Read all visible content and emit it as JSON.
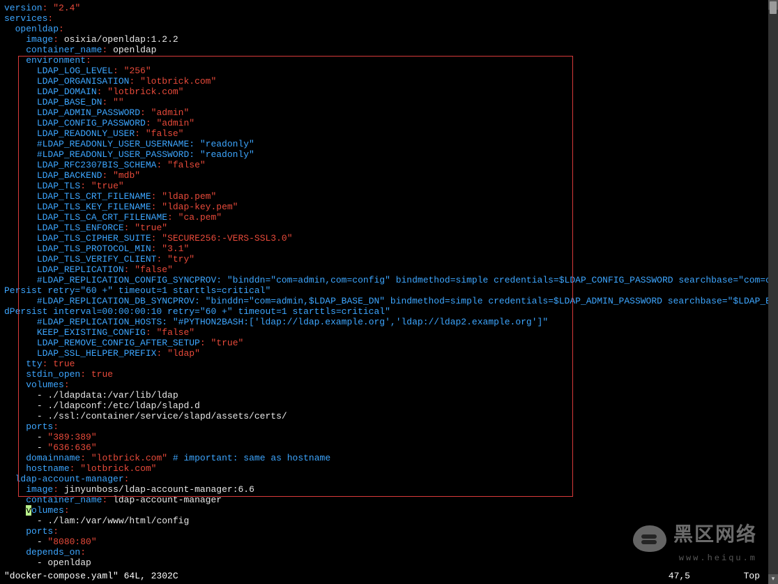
{
  "version": "2.4",
  "services": {
    "openldap": {
      "image": "osixia/openldap:1.2.2",
      "container_name": "openldap",
      "environment": {
        "LDAP_LOG_LEVEL": "256",
        "LDAP_ORGANISATION": "lotbrick.com",
        "LDAP_DOMAIN": "lotbrick.com",
        "LDAP_BASE_DN": "",
        "LDAP_ADMIN_PASSWORD": "admin",
        "LDAP_CONFIG_PASSWORD": "admin",
        "LDAP_READONLY_USER": "false",
        "LDAP_READONLY_USER_USERNAME_comment": "readonly",
        "LDAP_READONLY_USER_PASSWORD_comment": "readonly",
        "LDAP_RFC2307BIS_SCHEMA": "false",
        "LDAP_BACKEND": "mdb",
        "LDAP_TLS": "true",
        "LDAP_TLS_CRT_FILENAME": "ldap.pem",
        "LDAP_TLS_KEY_FILENAME": "ldap-key.pem",
        "LDAP_TLS_CA_CRT_FILENAME": "ca.pem",
        "LDAP_TLS_ENFORCE": "true",
        "LDAP_TLS_CIPHER_SUITE": "SECURE256:-VERS-SSL3.0",
        "LDAP_TLS_PROTOCOL_MIN": "3.1",
        "LDAP_TLS_VERIFY_CLIENT": "try",
        "LDAP_REPLICATION": "false",
        "LDAP_REPLICATION_CONFIG_SYNCPROV_comment": "binddn=\"com=admin,com=config\" bindmethod=simple credentials=$LDAP_CONFIG_PASSWORD searchbase=\"com=config\" type=refreshAndPersist retry=\"60 +\" timeout=1 starttls=critical",
        "LDAP_REPLICATION_DB_SYNCPROV_comment": "binddn=\"com=admin,$LDAP_BASE_DN\" bindmethod=simple credentials=$LDAP_ADMIN_PASSWORD searchbase=\"$LDAP_BASE_DN\" type=refreshAndPersist interval=00:00:00:10 retry=\"60 +\" timeout=1 starttls=critical",
        "LDAP_REPLICATION_HOSTS_comment": "#PYTHON2BASH:['ldap://ldap.example.org','ldap://ldap2.example.org']",
        "KEEP_EXISTING_CONFIG": "false",
        "LDAP_REMOVE_CONFIG_AFTER_SETUP": "true",
        "LDAP_SSL_HELPER_PREFIX": "ldap"
      },
      "tty": "true",
      "stdin_open": "true",
      "volumes": [
        "./ldapdata:/var/lib/ldap",
        "./ldapconf:/etc/ldap/slapd.d",
        "./ssl:/container/service/slapd/assets/certs/"
      ],
      "ports": [
        "389:389",
        "636:636"
      ],
      "domainname": "lotbrick.com",
      "domainname_comment": "# important: same as hostname",
      "hostname": "lotbrick.com"
    },
    "ldap-account-manager": {
      "image": "jinyunboss/ldap-account-manager:6.6",
      "container_name": "ldap-account-manager",
      "volumes": [
        "./lam:/var/www/html/config"
      ],
      "ports": [
        "8080:80"
      ],
      "depends_on": [
        "openldap"
      ]
    }
  },
  "statusbar": {
    "file": "\"docker-compose.yaml\" 64L, 2302C",
    "position": "47,5",
    "scroll": "Top"
  },
  "watermark": {
    "text": "黑区网络",
    "sub": "www.heiqu.m"
  }
}
